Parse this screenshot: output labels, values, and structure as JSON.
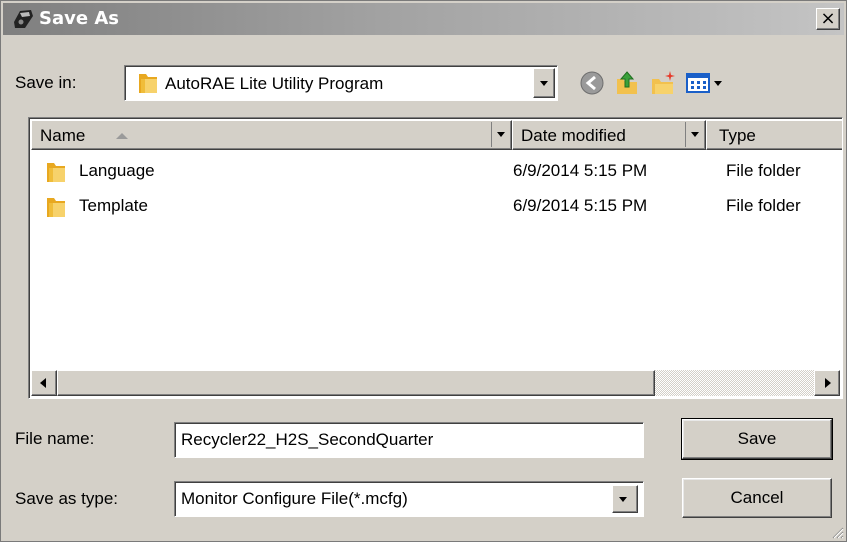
{
  "window": {
    "title": "Save As",
    "close_symbol": "×",
    "icon": "save-disk-icon"
  },
  "save_in": {
    "label": "Save in:",
    "value": "AutoRAE Lite Utility Program",
    "icon": "folder-icon"
  },
  "toolbar": {
    "back_icon": "back-icon",
    "up_icon": "up-folder-icon",
    "new_folder_icon": "new-folder-icon",
    "views_icon": "views-menu-icon"
  },
  "columns": [
    {
      "label": "Name"
    },
    {
      "label": "Date modified"
    },
    {
      "label": "Type"
    }
  ],
  "files": [
    {
      "name": "Language",
      "date": "6/9/2014 5:15 PM",
      "type": "File folder"
    },
    {
      "name": "Template",
      "date": "6/9/2014 5:15 PM",
      "type": "File folder"
    }
  ],
  "file_name": {
    "label": "File name:",
    "value": "Recycler22_H2S_SecondQuarter"
  },
  "save_as_type": {
    "label": "Save as type:",
    "value": "Monitor Configure File(*.mcfg)"
  },
  "buttons": {
    "save": "Save",
    "cancel": "Cancel"
  },
  "colors": {
    "face": "#d4d0c8",
    "folder": "#f2c14e"
  }
}
